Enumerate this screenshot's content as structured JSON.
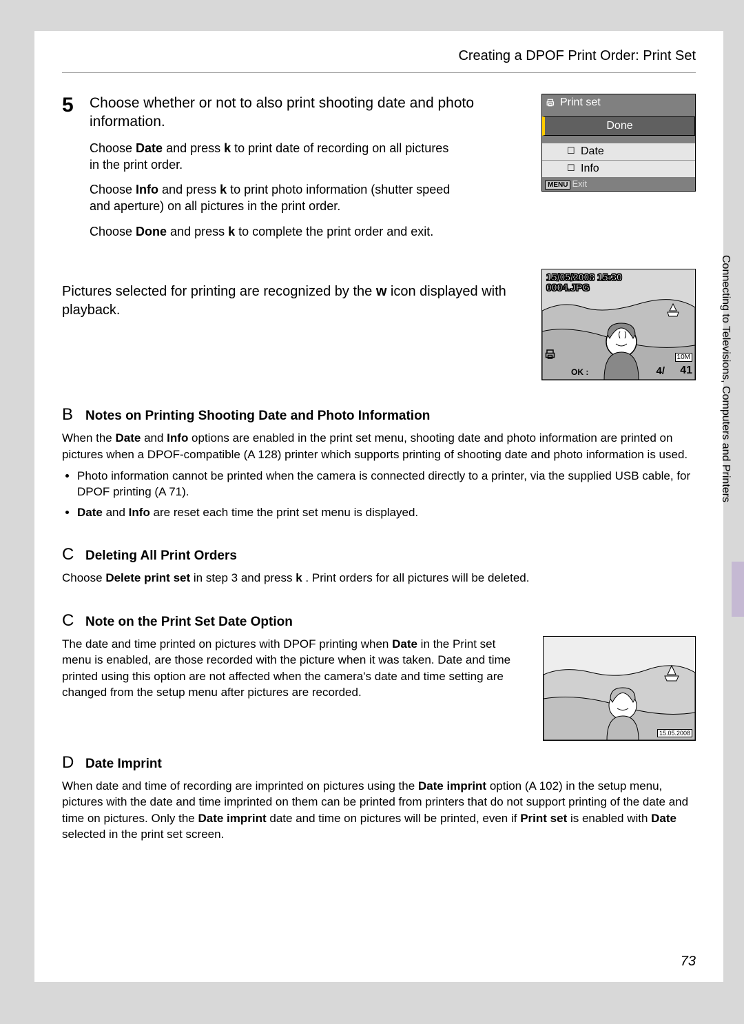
{
  "header": {
    "title": "Creating a DPOF Print Order: Print Set"
  },
  "side_text": "Connecting to Televisions, Computers and Printers",
  "step": {
    "number": "5",
    "title": "Choose whether or not to also print shooting date and photo information.",
    "p1_pre": "Choose ",
    "p1_b": "Date",
    "p1_mid": " and press ",
    "p1_k": "k",
    "p1_post": "   to print date of recording on all pictures in the print order.",
    "p2_pre": "Choose ",
    "p2_b": "Info",
    "p2_mid": " and press ",
    "p2_k": "k",
    "p2_post": "   to print photo information (shutter speed and aperture) on all pictures in the print order.",
    "p3_pre": "Choose ",
    "p3_b": "Done",
    "p3_mid": " and press ",
    "p3_k": "k",
    "p3_post": "   to complete the print order and exit."
  },
  "lcd": {
    "title": "Print set",
    "done": "Done",
    "date": "Date",
    "info": "Info",
    "exit": "Exit"
  },
  "recognition": {
    "pre": "Pictures selected for printing are recognized by the ",
    "icon": "w",
    "post": " icon displayed with playback."
  },
  "thumb": {
    "date": "15/05/2008 15:30",
    "file": "0004.JPG",
    "ok": "OK : ",
    "count": "4/",
    "total": "41",
    "size_icon": "10M"
  },
  "notes": {
    "b": {
      "glyph": "B",
      "title": "Notes on Printing Shooting Date and Photo Information",
      "p1_a": "When the ",
      "p1_b1": "Date",
      "p1_b": " and ",
      "p1_b2": "Info",
      "p1_c": " options are enabled in the print set menu, shooting date and photo information are printed on pictures when a DPOF-compatible (",
      "p1_ref": "A   128",
      "p1_d": ") printer which supports printing of shooting date and photo information is used.",
      "li1": "Photo information cannot be printed when the camera is connected directly to a printer, via the supplied USB cable, for DPOF printing (A   71).",
      "li2_a": "",
      "li2_b1": "Date",
      "li2_mid": " and ",
      "li2_b2": "Info",
      "li2_c": " are reset each time the print set menu is displayed."
    },
    "c1": {
      "glyph": "C",
      "title": "Deleting All Print Orders",
      "p_a": "Choose ",
      "p_b": "Delete print set",
      "p_c": " in step 3 and press ",
      "p_k": "k",
      "p_d": "  . Print orders for all pictures will be deleted."
    },
    "c2": {
      "glyph": "C",
      "title": "Note on the Print Set Date Option",
      "p_a": "The date and time printed on pictures with DPOF printing when ",
      "p_b": "Date",
      "p_c": " in the Print set menu is enabled, are those recorded with the picture when it was taken. Date and time printed using this option are not affected when the camera's date and time setting are changed from the setup menu after pictures are recorded."
    },
    "d": {
      "glyph": "D",
      "title": "Date Imprint",
      "p_a": "When date and time of recording are imprinted on pictures using the ",
      "p_b1": "Date imprint",
      "p_b": " option (",
      "p_ref": "A   102",
      "p_c": ") in the setup menu, pictures with the date and time imprinted on them can be printed from printers that do not support printing of the date and time on pictures. Only the ",
      "p_b2": "Date imprint",
      "p_d": " date and time on pictures will be printed, even if ",
      "p_b3": "Print set",
      "p_e": " is enabled with ",
      "p_b4": "Date",
      "p_f": " selected in the print set screen."
    }
  },
  "thumb2": {
    "date": "15.05.2008"
  },
  "page_number": "73"
}
